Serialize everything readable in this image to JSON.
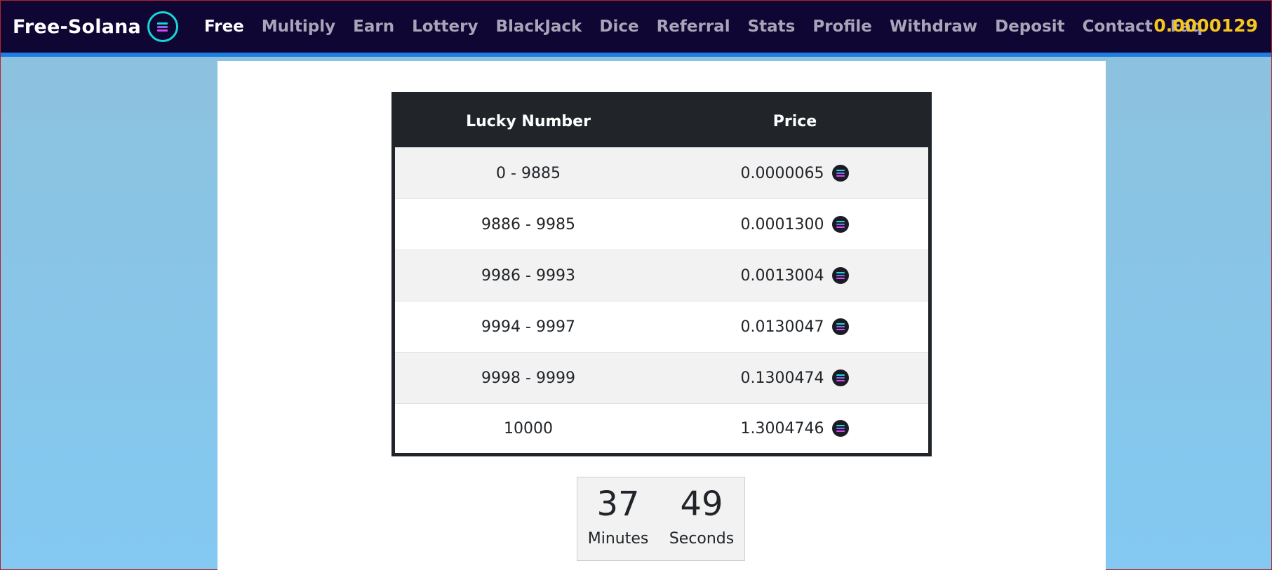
{
  "brand": {
    "name": "Free-Solana"
  },
  "nav": [
    {
      "label": "Free",
      "active": true
    },
    {
      "label": "Multiply",
      "active": false
    },
    {
      "label": "Earn",
      "active": false
    },
    {
      "label": "Lottery",
      "active": false
    },
    {
      "label": "BlackJack",
      "active": false
    },
    {
      "label": "Dice",
      "active": false
    },
    {
      "label": "Referral",
      "active": false
    },
    {
      "label": "Stats",
      "active": false
    },
    {
      "label": "Profile",
      "active": false
    },
    {
      "label": "Withdraw",
      "active": false
    },
    {
      "label": "Deposit",
      "active": false
    },
    {
      "label": "Contact",
      "active": false
    },
    {
      "label": "Faq",
      "active": false
    }
  ],
  "balance": "0.0000129",
  "table": {
    "headers": [
      "Lucky Number",
      "Price"
    ],
    "rows": [
      {
        "range": "0 - 9885",
        "price": "0.0000065"
      },
      {
        "range": "9886 - 9985",
        "price": "0.0001300"
      },
      {
        "range": "9986 - 9993",
        "price": "0.0013004"
      },
      {
        "range": "9994 - 9997",
        "price": "0.0130047"
      },
      {
        "range": "9998 - 9999",
        "price": "0.1300474"
      },
      {
        "range": "10000",
        "price": "1.3004746"
      }
    ]
  },
  "countdown": {
    "minutes": "37",
    "minutes_label": "Minutes",
    "seconds": "49",
    "seconds_label": "Seconds"
  },
  "icons": {
    "coin": "solana-coin-icon"
  },
  "colors": {
    "navbar": "#0f0634",
    "nav_accent": "#1f7de0",
    "balance": "#f5c71a",
    "coin_ring": "#19d6d6",
    "sol_bar_top": "#19d6d6",
    "sol_bar_mid": "#7b6cf0",
    "sol_bar_bottom": "#d946ef"
  }
}
